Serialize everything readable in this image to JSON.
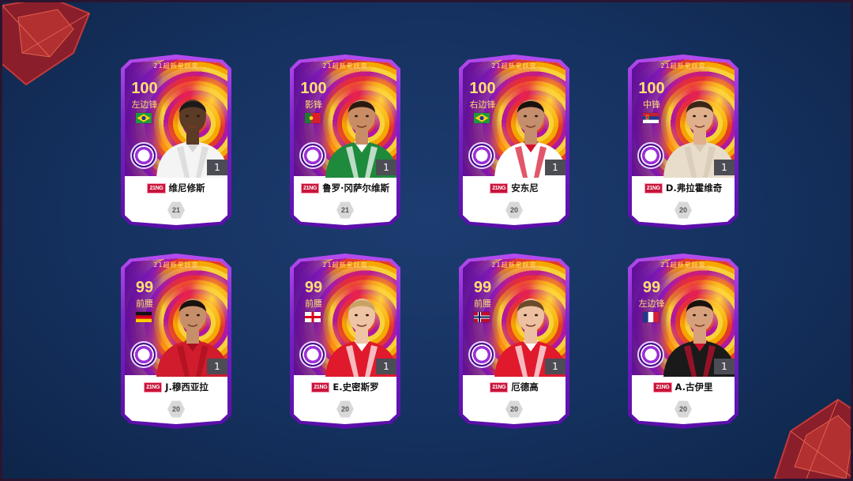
{
  "colors": {
    "background": "#15315f",
    "card_frame": "#7c22c9",
    "rating_text": "#ffe070",
    "season_tag": "#c8143a",
    "level_box": "#4c4c55"
  },
  "cards": [
    {
      "set_title": "21超新星跃变",
      "rating": "100",
      "position": "左边锋",
      "flag": "brazil",
      "player_name": "维尼修斯",
      "season_tag": "21NG",
      "level": "1",
      "grade": "21",
      "kit": "#f4f4f4",
      "kit_stripe": "#d4d4d4",
      "skin": "#5b3a26",
      "hair": "#1a1a1a"
    },
    {
      "set_title": "21超新星跃变",
      "rating": "100",
      "position": "影锋",
      "flag": "portugal",
      "player_name": "鲁罗·冈萨尔维斯",
      "season_tag": "21NG",
      "level": "1",
      "grade": "21",
      "kit": "#1e8a3c",
      "kit_stripe": "#ffffff",
      "skin": "#c98d66",
      "hair": "#2a1a10"
    },
    {
      "set_title": "21超新星跃变",
      "rating": "100",
      "position": "右边锋",
      "flag": "brazil",
      "player_name": "安东尼",
      "season_tag": "21NG",
      "level": "1",
      "grade": "20",
      "kit": "#ffffff",
      "kit_stripe": "#d6102a",
      "skin": "#c58e6c",
      "hair": "#1b120c"
    },
    {
      "set_title": "21超新星跃变",
      "rating": "100",
      "position": "中锋",
      "flag": "serbia",
      "player_name": "D.弗拉霍维奇",
      "season_tag": "21NG",
      "level": "1",
      "grade": "20",
      "kit": "#e8dccb",
      "kit_stripe": "#d6c8b4",
      "skin": "#e0b08c",
      "hair": "#3a2516"
    },
    {
      "set_title": "21超新星跃变",
      "rating": "99",
      "position": "前腰",
      "flag": "germany",
      "player_name": "J.穆西亚拉",
      "season_tag": "21NG",
      "level": "1",
      "grade": "20",
      "kit": "#d01c2c",
      "kit_stripe": "#a8101e",
      "skin": "#c68f6a",
      "hair": "#1a120c"
    },
    {
      "set_title": "21超新星跃变",
      "rating": "99",
      "position": "前腰",
      "flag": "england",
      "player_name": "E.史密斯罗",
      "season_tag": "21NG",
      "level": "1",
      "grade": "20",
      "kit": "#e0192c",
      "kit_stripe": "#ffffff",
      "skin": "#eec4a4",
      "hair": "#c7a466"
    },
    {
      "set_title": "21超新星跃变",
      "rating": "99",
      "position": "前腰",
      "flag": "norway",
      "player_name": "厄德高",
      "season_tag": "21NG",
      "level": "1",
      "grade": "20",
      "kit": "#e0192c",
      "kit_stripe": "#ffffff",
      "skin": "#ecc0a0",
      "hair": "#6a4a2a"
    },
    {
      "set_title": "21超新星跃变",
      "rating": "99",
      "position": "左边锋",
      "flag": "france",
      "player_name": "A.古伊里",
      "season_tag": "21NG",
      "level": "1",
      "grade": "20",
      "kit": "#1a1a1a",
      "kit_stripe": "#c8102e",
      "skin": "#d7a07c",
      "hair": "#1a120c"
    }
  ]
}
